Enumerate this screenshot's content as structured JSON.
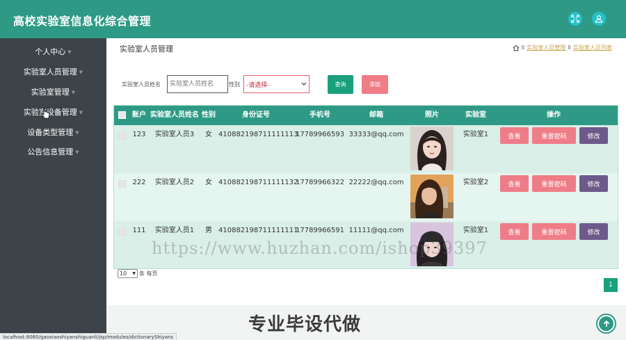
{
  "app": {
    "title": "高校实验室信息化综合管理"
  },
  "header_icons": [
    "fullscreen-icon",
    "user-icon"
  ],
  "sidebar": {
    "items": [
      {
        "label": "个人中心"
      },
      {
        "label": "实验室人员管理"
      },
      {
        "label": "实验室管理"
      },
      {
        "label": "实验室设备管理"
      },
      {
        "label": "设备类型管理"
      },
      {
        "label": "公告信息管理"
      }
    ]
  },
  "page": {
    "heading": "实验室人员管理",
    "breadcrumb": [
      "实验室人员管理",
      "实验室人员列表"
    ]
  },
  "search": {
    "name_label": "实验室人员姓名",
    "name_placeholder": "实验室人员姓名",
    "gender_label": "性别",
    "gender_value": "-请选择-",
    "query_label": "查询",
    "add_label": "添加"
  },
  "table": {
    "headers": [
      "账户",
      "实验室人员姓名",
      "性别",
      "身份证号",
      "手机号",
      "邮箱",
      "照片",
      "实验室",
      "操作"
    ],
    "rows": [
      {
        "account": "123",
        "name": "实验室人员3",
        "gender": "女",
        "id_number": "410882198711111113",
        "phone": "17789966593",
        "email": "33333@qq.com",
        "lab": "实验室1"
      },
      {
        "account": "222",
        "name": "实验室人员2",
        "gender": "女",
        "id_number": "410882198711111132",
        "phone": "17789966322",
        "email": "22222@qq.com",
        "lab": "实验室2"
      },
      {
        "account": "111",
        "name": "实验室人员1",
        "gender": "男",
        "id_number": "410882198711111111",
        "phone": "17789966591",
        "email": "11111@qq.com",
        "lab": "实验室1"
      }
    ],
    "actions": {
      "view": "查看",
      "reset": "重置密码",
      "edit": "修改"
    }
  },
  "pagination": {
    "page_size": "10",
    "page_size_suffix": "条 每页",
    "current_page": "1"
  },
  "footer": {
    "banner": "专业毕设代做"
  },
  "status_url": "localhost:8080/gaoxiaoshiyanshiguanli/jsp/modules/dictionaryShiyans",
  "watermark": "https://www.huzhan.com/ishop39397",
  "colors": {
    "primary": "#2e9a86",
    "sidebar": "#3d4449",
    "danger": "#ee7d88",
    "edit": "#6d5a8a",
    "query": "#1aa07c"
  }
}
